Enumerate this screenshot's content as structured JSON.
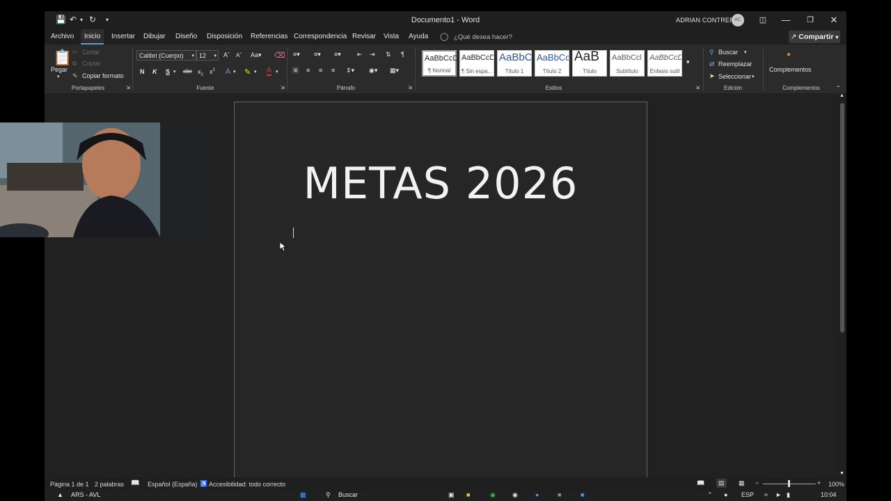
{
  "titlebar": {
    "title": "Documento1  -  Word",
    "user": "ADRIAN CONTRERAS",
    "avatar": "AC"
  },
  "menu": {
    "tabs": [
      "Archivo",
      "Inicio",
      "Insertar",
      "Dibujar",
      "Diseño",
      "Disposición",
      "Referencias",
      "Correspondencia",
      "Revisar",
      "Vista",
      "Ayuda"
    ],
    "active": "Inicio",
    "search_placeholder": "¿Qué desea hacer?",
    "share": "Compartir"
  },
  "ribbon": {
    "clipboard": {
      "paste": "Pegar",
      "cut": "Cortar",
      "copy": "Copiar",
      "format_painter": "Copiar formato",
      "label": "Portapapeles"
    },
    "font": {
      "name": "Calibri (Cuerpo)",
      "size": "12",
      "bold": "N",
      "italic": "K",
      "underline": "S",
      "strike": "abc",
      "sub": "x",
      "sup": "x",
      "label": "Fuente"
    },
    "paragraph": {
      "label": "Párrafo"
    },
    "styles": {
      "label": "Estilos",
      "items": [
        {
          "sample": "AaBbCcD",
          "name": "¶ Normal"
        },
        {
          "sample": "AaBbCcD",
          "name": "¶ Sin espa..."
        },
        {
          "sample": "AaBbC",
          "name": "Título 1"
        },
        {
          "sample": "AaBbCc",
          "name": "Título 2"
        },
        {
          "sample": "AaB",
          "name": "Título"
        },
        {
          "sample": "AaBbCcl",
          "name": "Subtítulo"
        },
        {
          "sample": "AaBbCcD",
          "name": "Énfasis sutil"
        }
      ]
    },
    "editing": {
      "find": "Buscar",
      "replace": "Reemplazar",
      "select": "Seleccionar",
      "label": "Edición"
    },
    "addins": {
      "button": "Complementos",
      "label": "Complementos"
    }
  },
  "document": {
    "heading": "METAS 2026"
  },
  "status": {
    "page": "Página 1 de 1",
    "words": "2 palabras",
    "language": "Español (España)",
    "accessibility": "Accesibilidad: todo correcto",
    "zoom": "100%"
  },
  "taskbar": {
    "stock": "ARS - AVL",
    "search": "Buscar",
    "lang": "ESP",
    "time": "10:04"
  }
}
